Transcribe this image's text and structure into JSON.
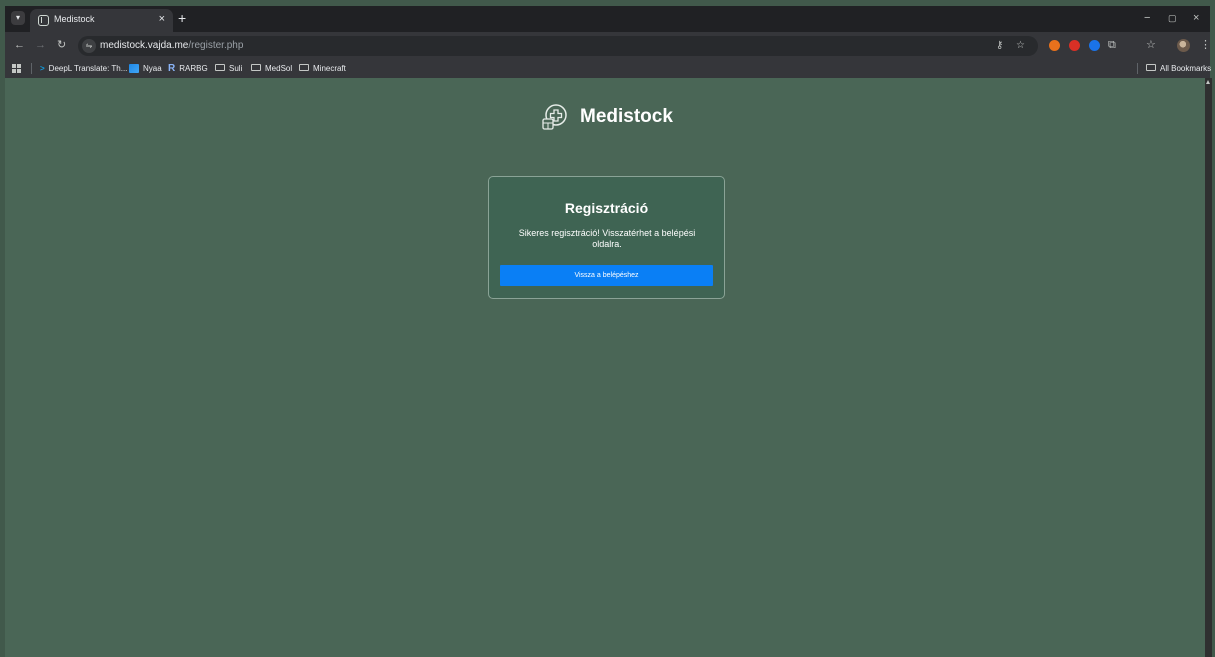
{
  "browser": {
    "tab": {
      "title": "Medistock",
      "close_glyph": "×"
    },
    "new_tab_glyph": "+",
    "window_controls": {
      "minimize": "−",
      "restore": "▢",
      "close": "×"
    },
    "address_bar": {
      "host": "medistock.vajda.me",
      "path": "/register.php"
    },
    "bookmarks": [
      {
        "label": "DeepL Translate: Th...",
        "icon": "deepl-icon"
      },
      {
        "label": "Nyaa",
        "icon": "nyaa-icon"
      },
      {
        "label": "RARBG",
        "icon": "rarbg-icon"
      },
      {
        "label": "Suli",
        "icon": "folder-icon"
      },
      {
        "label": "MedSol",
        "icon": "folder-icon"
      },
      {
        "label": "Minecraft",
        "icon": "folder-icon"
      }
    ],
    "all_bookmarks_label": "All Bookmarks",
    "extension_colors": [
      "#e8711c",
      "#d93025",
      "#1a73e8"
    ]
  },
  "page": {
    "brand": {
      "name": "Medistock",
      "icon": "medical-box-icon"
    },
    "card": {
      "title": "Regisztráció",
      "message": "Sikeres regisztráció! Visszatérhet a belépési oldalra.",
      "button_label": "Vissza a belépéshez"
    },
    "colors": {
      "background": "#4a6656",
      "card_background": "#3f6453",
      "button": "#0a7ff5"
    }
  }
}
